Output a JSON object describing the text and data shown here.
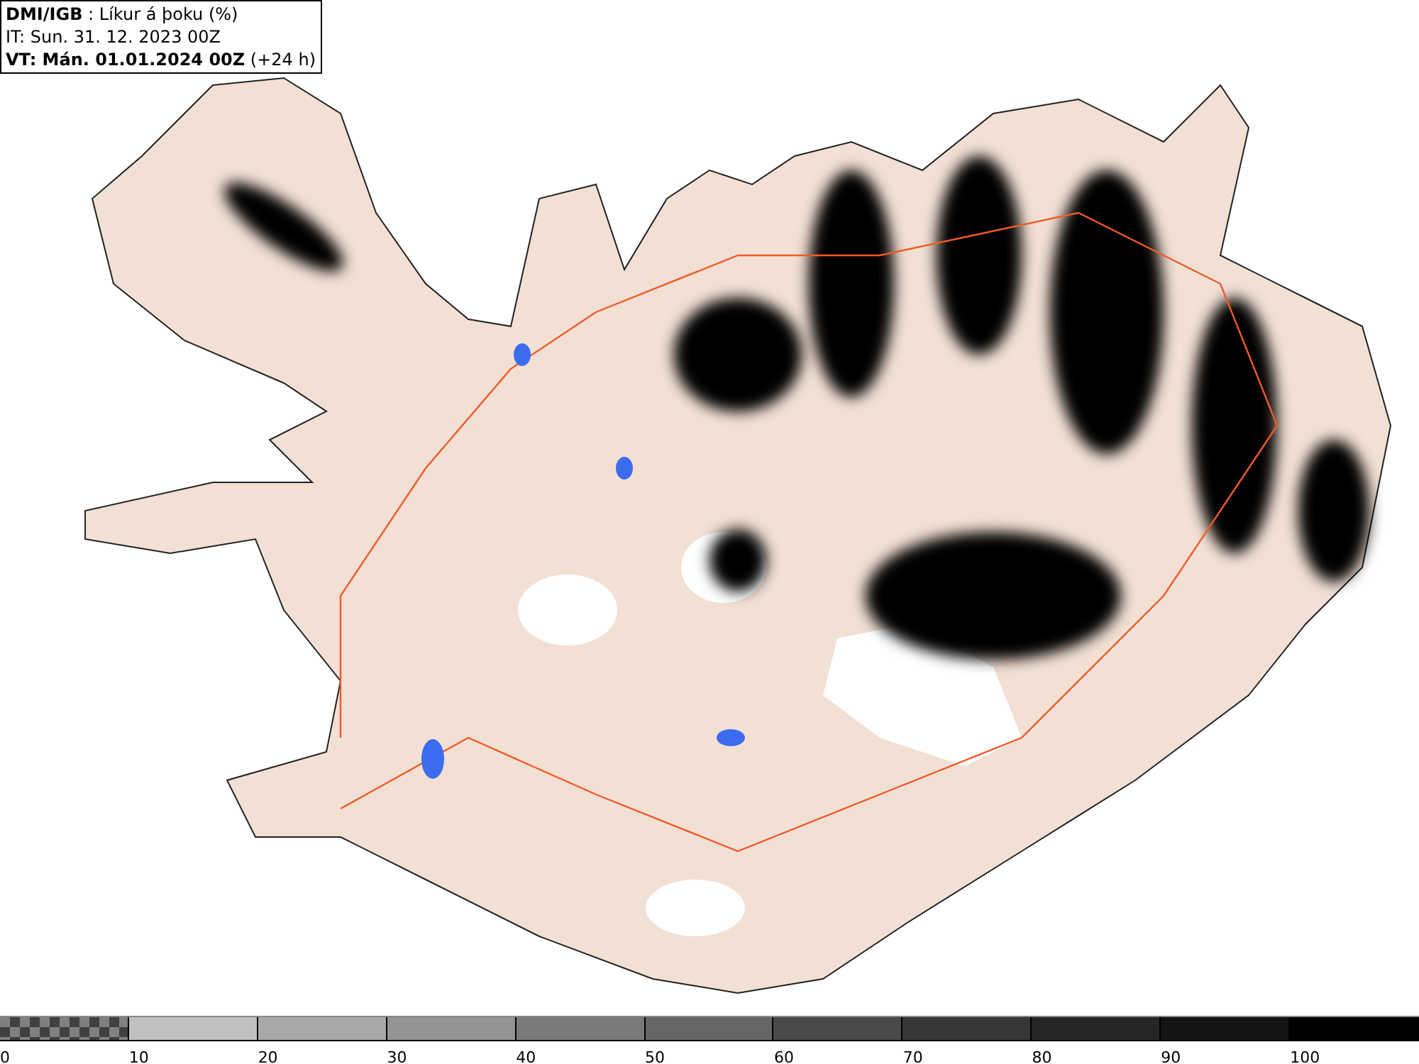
{
  "header": {
    "lines": [
      "**DMI/IGB** : Líkur á þoku (%)",
      "IT: Sun. 31. 12. 2023 00Z",
      "**VT: Mán. 01.01.2024 00Z** (+24 h)"
    ]
  },
  "legend": {
    "items": [
      {
        "label": "0",
        "kind": "checker"
      },
      {
        "label": "10",
        "kind": "solid",
        "color": "#c0c0c0"
      },
      {
        "label": "20",
        "kind": "solid",
        "color": "#a8a8a8"
      },
      {
        "label": "30",
        "kind": "solid",
        "color": "#949494"
      },
      {
        "label": "40",
        "kind": "solid",
        "color": "#7a7a7a"
      },
      {
        "label": "50",
        "kind": "solid",
        "color": "#666666"
      },
      {
        "label": "60",
        "kind": "solid",
        "color": "#4a4a4a"
      },
      {
        "label": "70",
        "kind": "solid",
        "color": "#363636"
      },
      {
        "label": "80",
        "kind": "solid",
        "color": "#262626"
      },
      {
        "label": "90",
        "kind": "solid",
        "color": "#141414"
      },
      {
        "label": "100",
        "kind": "solid",
        "color": "#000000"
      }
    ]
  }
}
